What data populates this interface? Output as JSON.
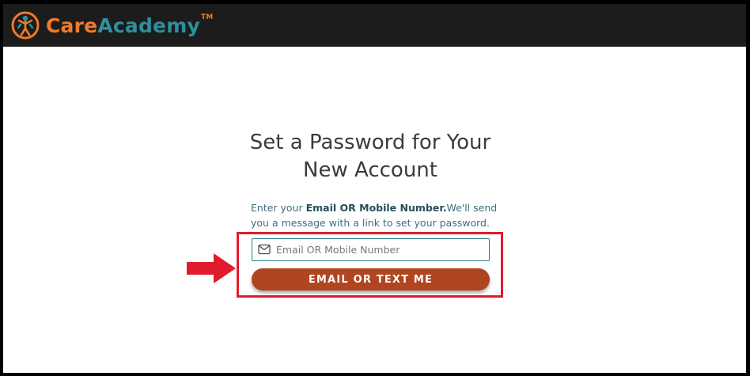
{
  "header": {
    "brand_part1": "Care",
    "brand_part2": "Academy",
    "brand_tm": "TM"
  },
  "main": {
    "title_line1": "Set a Password for Your",
    "title_line2": "New Account",
    "desc_prefix": "Enter your ",
    "desc_strong": "Email OR Mobile Number.",
    "desc_suffix": "We'll send you a message with a link to set your password.",
    "input_value": "",
    "input_placeholder": "Email OR Mobile Number",
    "submit_label": "EMAIL OR TEXT ME"
  },
  "icons": {
    "logo": "care-academy-logo-icon",
    "mail": "mail-icon",
    "annotation": "red-arrow-icon"
  },
  "colors": {
    "topbar_bg": "#1c1c1c",
    "brand_orange": "#f07a2a",
    "brand_teal": "#2f8f9d",
    "button_bg": "#b04520",
    "highlight_red": "#e01b2d"
  }
}
